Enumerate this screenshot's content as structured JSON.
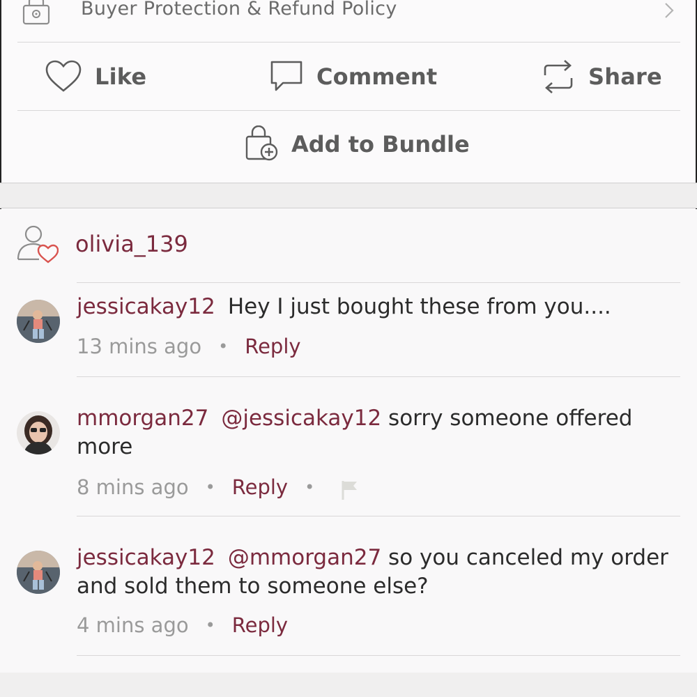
{
  "policy": {
    "label": "Buyer Protection & Refund Policy"
  },
  "actions": {
    "like": "Like",
    "comment": "Comment",
    "share": "Share",
    "bundle": "Add to Bundle"
  },
  "tagged_user": "olivia_139",
  "comments": [
    {
      "user": "jessicakay12",
      "mention": "",
      "text": "Hey I just bought these from you....",
      "time": "13 mins ago",
      "reply": "Reply"
    },
    {
      "user": "mmorgan27",
      "mention": "@jessicakay12",
      "text": " sorry someone offered more",
      "time": "8 mins ago",
      "reply": "Reply"
    },
    {
      "user": "jessicakay12",
      "mention": "@mmorgan27",
      "text": " so you canceled my order and sold them to someone else?",
      "time": "4 mins ago",
      "reply": "Reply"
    }
  ],
  "colors": {
    "accent": "#7b2a3e",
    "muted": "#9a9a9a",
    "heart": "#d9534f"
  },
  "icons": [
    "lock-icon",
    "chevron-right-icon",
    "heart-icon",
    "comment-icon",
    "share-icon",
    "bundle-bag-icon",
    "user-heart-icon",
    "flag-icon"
  ]
}
